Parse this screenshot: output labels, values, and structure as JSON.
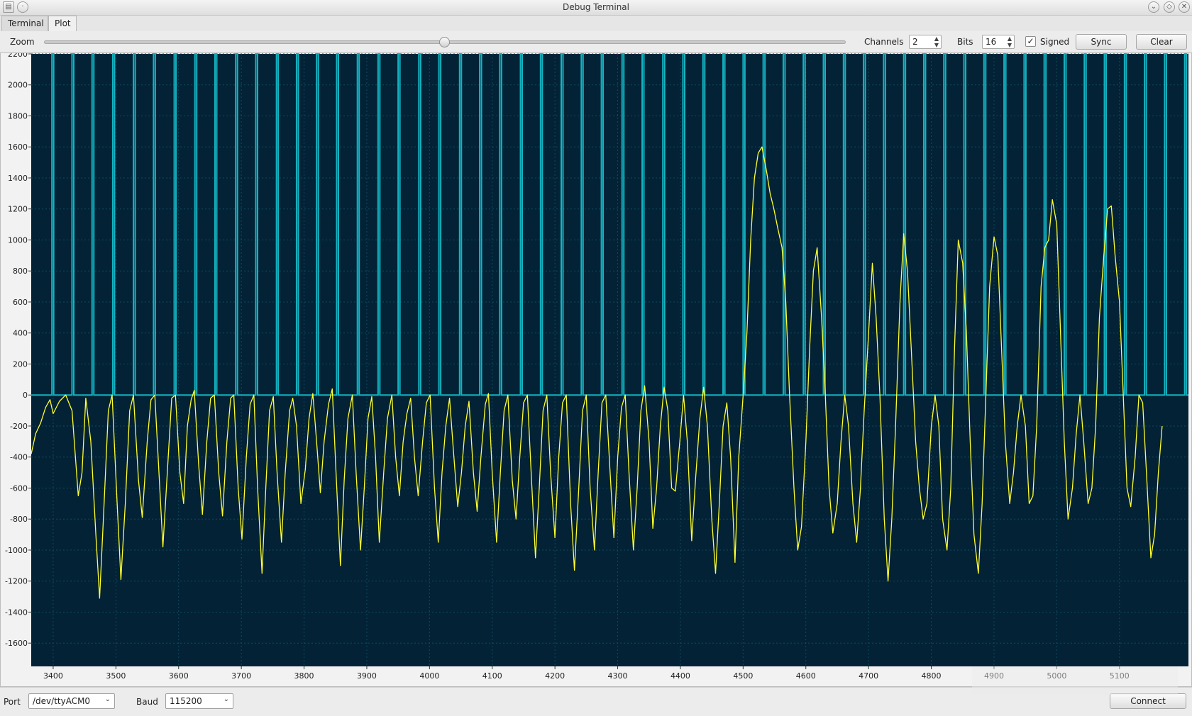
{
  "window": {
    "title": "Debug Terminal"
  },
  "tabs": [
    {
      "label": "Terminal",
      "active": false
    },
    {
      "label": "Plot",
      "active": true
    }
  ],
  "toolbar": {
    "zoom_label": "Zoom",
    "zoom_value": 0.5,
    "channels_label": "Channels",
    "channels_value": "2",
    "bits_label": "Bits",
    "bits_value": "16",
    "signed_label": "Signed",
    "signed_checked": true,
    "sync_label": "Sync",
    "clear_label": "Clear"
  },
  "bottom": {
    "port_label": "Port",
    "port_value": "/dev/ttyACM0",
    "baud_label": "Baud",
    "baud_value": "115200",
    "connect_label": "Connect"
  },
  "colors": {
    "plot_bg": "#032236",
    "grid": "#0e4a5e",
    "channel1": "#ffff2e",
    "channel2": "#13b3c1"
  },
  "chart_data": {
    "type": "line",
    "xlim": [
      3365,
      5210
    ],
    "ylim": [
      -1750,
      2200
    ],
    "xticks": [
      3400,
      3500,
      3600,
      3700,
      3800,
      3900,
      4000,
      4100,
      4200,
      4300,
      4400,
      4500,
      4600,
      4700,
      4800,
      4900,
      5000,
      5100
    ],
    "yticks": [
      2200,
      2000,
      1800,
      1600,
      1400,
      1200,
      1000,
      800,
      600,
      400,
      200,
      0,
      -200,
      -400,
      -600,
      -800,
      -1000,
      -1200,
      -1400,
      -1600
    ],
    "grid": true,
    "series": [
      {
        "channel": 2,
        "style": "pulses",
        "low": 0,
        "high": 2200,
        "pulse_x": [
          3398,
          3430,
          3462,
          3495,
          3528,
          3560,
          3593,
          3626,
          3658,
          3691,
          3723,
          3756,
          3788,
          3820,
          3852,
          3885,
          3918,
          3950,
          3983,
          4015,
          4048,
          4080,
          4112,
          4145,
          4177,
          4210,
          4242,
          4274,
          4307,
          4339,
          4372,
          4404,
          4436,
          4468,
          4500,
          4532,
          4564,
          4596,
          4628,
          4660,
          4692,
          4724,
          4756,
          4788,
          4820,
          4852,
          4884,
          4916,
          4948,
          4980,
          5012,
          5044,
          5076,
          5108,
          5140,
          5172,
          5204
        ]
      },
      {
        "channel": 1,
        "style": "waveform",
        "points": [
          [
            3365,
            -380
          ],
          [
            3372,
            -250
          ],
          [
            3380,
            -180
          ],
          [
            3388,
            -80
          ],
          [
            3395,
            -30
          ],
          [
            3400,
            -120
          ],
          [
            3410,
            -40
          ],
          [
            3420,
            0
          ],
          [
            3430,
            -100
          ],
          [
            3440,
            -650
          ],
          [
            3446,
            -500
          ],
          [
            3452,
            -20
          ],
          [
            3460,
            -300
          ],
          [
            3468,
            -900
          ],
          [
            3474,
            -1310
          ],
          [
            3480,
            -800
          ],
          [
            3488,
            -100
          ],
          [
            3494,
            0
          ],
          [
            3502,
            -700
          ],
          [
            3508,
            -1190
          ],
          [
            3515,
            -700
          ],
          [
            3522,
            -100
          ],
          [
            3528,
            0
          ],
          [
            3536,
            -550
          ],
          [
            3542,
            -790
          ],
          [
            3550,
            -300
          ],
          [
            3556,
            -30
          ],
          [
            3562,
            0
          ],
          [
            3570,
            -600
          ],
          [
            3575,
            -980
          ],
          [
            3582,
            -500
          ],
          [
            3589,
            -20
          ],
          [
            3595,
            0
          ],
          [
            3602,
            -500
          ],
          [
            3608,
            -700
          ],
          [
            3614,
            -200
          ],
          [
            3620,
            -30
          ],
          [
            3625,
            30
          ],
          [
            3632,
            -450
          ],
          [
            3638,
            -770
          ],
          [
            3645,
            -300
          ],
          [
            3651,
            -20
          ],
          [
            3657,
            0
          ],
          [
            3664,
            -500
          ],
          [
            3670,
            -780
          ],
          [
            3677,
            -300
          ],
          [
            3683,
            -20
          ],
          [
            3688,
            0
          ],
          [
            3695,
            -600
          ],
          [
            3701,
            -930
          ],
          [
            3708,
            -400
          ],
          [
            3714,
            -60
          ],
          [
            3720,
            0
          ],
          [
            3726,
            -600
          ],
          [
            3733,
            -1150
          ],
          [
            3739,
            -600
          ],
          [
            3745,
            -100
          ],
          [
            3751,
            -10
          ],
          [
            3757,
            -500
          ],
          [
            3764,
            -950
          ],
          [
            3770,
            -500
          ],
          [
            3777,
            -100
          ],
          [
            3782,
            -20
          ],
          [
            3788,
            -200
          ],
          [
            3795,
            -700
          ],
          [
            3802,
            -480
          ],
          [
            3808,
            -150
          ],
          [
            3814,
            10
          ],
          [
            3820,
            -300
          ],
          [
            3826,
            -630
          ],
          [
            3832,
            -300
          ],
          [
            3839,
            -60
          ],
          [
            3845,
            40
          ],
          [
            3851,
            -500
          ],
          [
            3858,
            -1100
          ],
          [
            3864,
            -550
          ],
          [
            3870,
            -150
          ],
          [
            3877,
            0
          ],
          [
            3883,
            -500
          ],
          [
            3890,
            -1000
          ],
          [
            3896,
            -600
          ],
          [
            3902,
            -150
          ],
          [
            3908,
            -10
          ],
          [
            3914,
            -400
          ],
          [
            3920,
            -950
          ],
          [
            3927,
            -500
          ],
          [
            3933,
            -150
          ],
          [
            3940,
            0
          ],
          [
            3946,
            -400
          ],
          [
            3952,
            -650
          ],
          [
            3958,
            -300
          ],
          [
            3964,
            -120
          ],
          [
            3970,
            -20
          ],
          [
            3976,
            -400
          ],
          [
            3982,
            -650
          ],
          [
            3989,
            -300
          ],
          [
            3995,
            -50
          ],
          [
            4001,
            0
          ],
          [
            4008,
            -600
          ],
          [
            4014,
            -950
          ],
          [
            4020,
            -500
          ],
          [
            4026,
            -200
          ],
          [
            4032,
            -20
          ],
          [
            4038,
            -350
          ],
          [
            4045,
            -720
          ],
          [
            4051,
            -500
          ],
          [
            4057,
            -200
          ],
          [
            4063,
            -40
          ],
          [
            4070,
            -500
          ],
          [
            4076,
            -750
          ],
          [
            4082,
            -400
          ],
          [
            4089,
            -60
          ],
          [
            4094,
            10
          ],
          [
            4100,
            -500
          ],
          [
            4107,
            -950
          ],
          [
            4113,
            -500
          ],
          [
            4119,
            -100
          ],
          [
            4125,
            0
          ],
          [
            4132,
            -550
          ],
          [
            4138,
            -800
          ],
          [
            4144,
            -400
          ],
          [
            4150,
            -50
          ],
          [
            4156,
            0
          ],
          [
            4162,
            -500
          ],
          [
            4169,
            -1050
          ],
          [
            4175,
            -600
          ],
          [
            4181,
            -100
          ],
          [
            4187,
            0
          ],
          [
            4193,
            -500
          ],
          [
            4200,
            -920
          ],
          [
            4206,
            -400
          ],
          [
            4212,
            -50
          ],
          [
            4218,
            0
          ],
          [
            4225,
            -700
          ],
          [
            4231,
            -1130
          ],
          [
            4238,
            -600
          ],
          [
            4244,
            -100
          ],
          [
            4250,
            0
          ],
          [
            4256,
            -600
          ],
          [
            4263,
            -1000
          ],
          [
            4269,
            -500
          ],
          [
            4275,
            -50
          ],
          [
            4281,
            0
          ],
          [
            4288,
            -500
          ],
          [
            4294,
            -920
          ],
          [
            4300,
            -400
          ],
          [
            4306,
            -80
          ],
          [
            4312,
            0
          ],
          [
            4318,
            -500
          ],
          [
            4325,
            -1000
          ],
          [
            4331,
            -600
          ],
          [
            4337,
            -100
          ],
          [
            4343,
            60
          ],
          [
            4350,
            -300
          ],
          [
            4356,
            -860
          ],
          [
            4362,
            -600
          ],
          [
            4368,
            -200
          ],
          [
            4374,
            50
          ],
          [
            4380,
            -100
          ],
          [
            4386,
            -600
          ],
          [
            4392,
            -620
          ],
          [
            4399,
            -300
          ],
          [
            4405,
            0
          ],
          [
            4411,
            -300
          ],
          [
            4418,
            -940
          ],
          [
            4424,
            -550
          ],
          [
            4431,
            -150
          ],
          [
            4437,
            50
          ],
          [
            4443,
            -200
          ],
          [
            4450,
            -800
          ],
          [
            4456,
            -1150
          ],
          [
            4462,
            -700
          ],
          [
            4468,
            -200
          ],
          [
            4474,
            -50
          ],
          [
            4480,
            -400
          ],
          [
            4487,
            -1080
          ],
          [
            4493,
            -400
          ],
          [
            4500,
            0
          ],
          [
            4506,
            400
          ],
          [
            4512,
            1000
          ],
          [
            4518,
            1400
          ],
          [
            4524,
            1560
          ],
          [
            4530,
            1600
          ],
          [
            4537,
            1450
          ],
          [
            4543,
            1300
          ],
          [
            4549,
            1200
          ],
          [
            4555,
            1080
          ],
          [
            4562,
            950
          ],
          [
            4568,
            600
          ],
          [
            4574,
            0
          ],
          [
            4581,
            -600
          ],
          [
            4587,
            -1000
          ],
          [
            4593,
            -850
          ],
          [
            4600,
            -300
          ],
          [
            4606,
            300
          ],
          [
            4612,
            800
          ],
          [
            4618,
            950
          ],
          [
            4625,
            500
          ],
          [
            4631,
            0
          ],
          [
            4637,
            -600
          ],
          [
            4643,
            -890
          ],
          [
            4650,
            -700
          ],
          [
            4656,
            -300
          ],
          [
            4662,
            0
          ],
          [
            4668,
            -200
          ],
          [
            4675,
            -700
          ],
          [
            4681,
            -950
          ],
          [
            4687,
            -600
          ],
          [
            4693,
            -100
          ],
          [
            4700,
            400
          ],
          [
            4706,
            850
          ],
          [
            4712,
            500
          ],
          [
            4718,
            0
          ],
          [
            4725,
            -800
          ],
          [
            4731,
            -1200
          ],
          [
            4737,
            -800
          ],
          [
            4743,
            -200
          ],
          [
            4750,
            600
          ],
          [
            4756,
            1040
          ],
          [
            4762,
            800
          ],
          [
            4768,
            300
          ],
          [
            4775,
            -300
          ],
          [
            4781,
            -600
          ],
          [
            4787,
            -800
          ],
          [
            4793,
            -700
          ],
          [
            4800,
            -200
          ],
          [
            4806,
            0
          ],
          [
            4812,
            -200
          ],
          [
            4818,
            -800
          ],
          [
            4825,
            -1000
          ],
          [
            4831,
            -600
          ],
          [
            4837,
            300
          ],
          [
            4843,
            1000
          ],
          [
            4850,
            850
          ],
          [
            4856,
            400
          ],
          [
            4862,
            -300
          ],
          [
            4868,
            -900
          ],
          [
            4875,
            -1150
          ],
          [
            4881,
            -700
          ],
          [
            4887,
            0
          ],
          [
            4893,
            700
          ],
          [
            4900,
            1020
          ],
          [
            4906,
            900
          ],
          [
            4912,
            300
          ],
          [
            4918,
            -300
          ],
          [
            4925,
            -700
          ],
          [
            4931,
            -500
          ],
          [
            4937,
            -200
          ],
          [
            4943,
            0
          ],
          [
            4950,
            -200
          ],
          [
            4956,
            -700
          ],
          [
            4962,
            -650
          ],
          [
            4968,
            -200
          ],
          [
            4975,
            700
          ],
          [
            4981,
            950
          ],
          [
            4987,
            1000
          ],
          [
            4993,
            1260
          ],
          [
            5000,
            1100
          ],
          [
            5006,
            400
          ],
          [
            5012,
            -300
          ],
          [
            5018,
            -800
          ],
          [
            5025,
            -600
          ],
          [
            5031,
            -250
          ],
          [
            5037,
            0
          ],
          [
            5043,
            -300
          ],
          [
            5050,
            -700
          ],
          [
            5056,
            -600
          ],
          [
            5062,
            -200
          ],
          [
            5068,
            500
          ],
          [
            5075,
            900
          ],
          [
            5081,
            1200
          ],
          [
            5087,
            1220
          ],
          [
            5093,
            900
          ],
          [
            5100,
            600
          ],
          [
            5106,
            0
          ],
          [
            5112,
            -600
          ],
          [
            5118,
            -720
          ],
          [
            5125,
            -400
          ],
          [
            5131,
            0
          ],
          [
            5137,
            -50
          ],
          [
            5143,
            -500
          ],
          [
            5150,
            -1050
          ],
          [
            5156,
            -900
          ],
          [
            5162,
            -500
          ],
          [
            5168,
            -200
          ]
        ]
      }
    ]
  }
}
